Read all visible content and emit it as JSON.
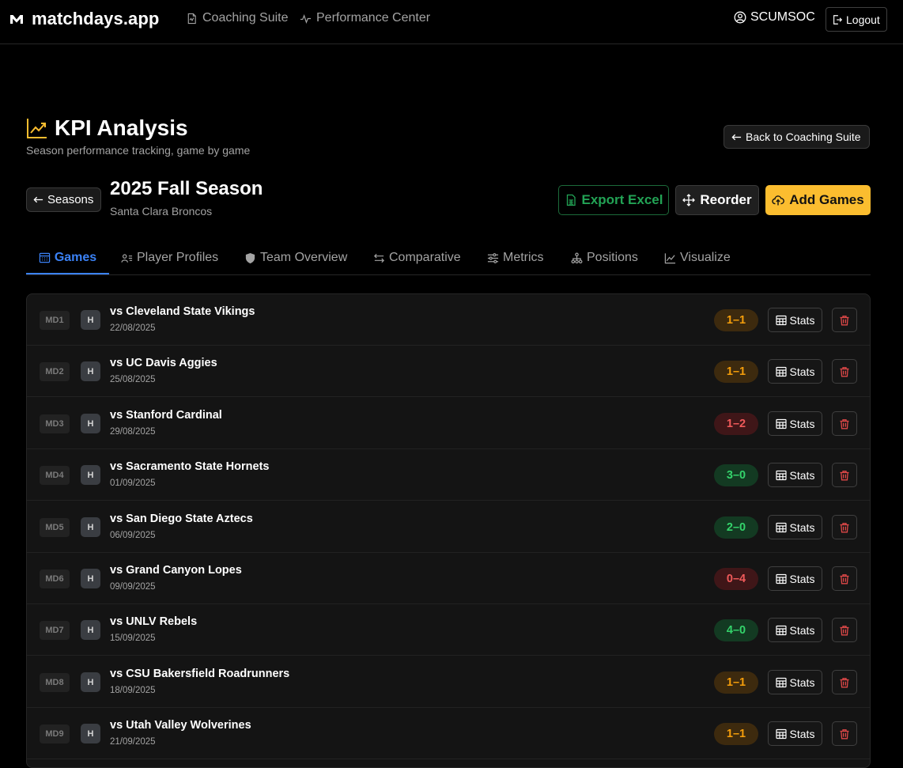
{
  "nav": {
    "brand": "matchdays.app",
    "links": [
      {
        "label": "Coaching Suite"
      },
      {
        "label": "Performance Center"
      }
    ],
    "user": "SCUMSOC",
    "logout": "Logout"
  },
  "header": {
    "title": "KPI Analysis",
    "subtitle": "Season performance tracking, game by game",
    "back_button": "Back to Coaching Suite"
  },
  "season": {
    "back_label": "Seasons",
    "title": "2025 Fall Season",
    "team": "Santa Clara Broncos"
  },
  "actions": {
    "export": "Export Excel",
    "reorder": "Reorder",
    "add": "Add Games"
  },
  "tabs": [
    {
      "label": "Games",
      "icon": "calendar-icon"
    },
    {
      "label": "Player Profiles",
      "icon": "player-card-icon"
    },
    {
      "label": "Team Overview",
      "icon": "shield-icon"
    },
    {
      "label": "Comparative",
      "icon": "arrows-compare-icon"
    },
    {
      "label": "Metrics",
      "icon": "sliders-icon"
    },
    {
      "label": "Positions",
      "icon": "positions-icon"
    },
    {
      "label": "Visualize",
      "icon": "line-chart-icon"
    }
  ],
  "colors": {
    "accent": "#3b82f6",
    "brand_yellow": "#fbbd2f",
    "export_green": "#22a355",
    "draw_text": "#f59e0b",
    "draw_bg": "#3d2a0e",
    "loss_text": "#f05a5a",
    "loss_bg": "#3f1618",
    "win_text": "#34d36b",
    "win_bg": "#133a22",
    "delete_red": "#e04848"
  },
  "games": [
    {
      "md": "MD1",
      "venue": "H",
      "opponent": "vs Cleveland State Vikings",
      "date": "22/08/2025",
      "score": "1–1",
      "result": "draw",
      "stats": "Stats"
    },
    {
      "md": "MD2",
      "venue": "H",
      "opponent": "vs UC Davis Aggies",
      "date": "25/08/2025",
      "score": "1–1",
      "result": "draw",
      "stats": "Stats"
    },
    {
      "md": "MD3",
      "venue": "H",
      "opponent": "vs Stanford Cardinal",
      "date": "29/08/2025",
      "score": "1–2",
      "result": "loss",
      "stats": "Stats"
    },
    {
      "md": "MD4",
      "venue": "H",
      "opponent": "vs Sacramento State Hornets",
      "date": "01/09/2025",
      "score": "3–0",
      "result": "win",
      "stats": "Stats"
    },
    {
      "md": "MD5",
      "venue": "H",
      "opponent": "vs San Diego State Aztecs",
      "date": "06/09/2025",
      "score": "2–0",
      "result": "win",
      "stats": "Stats"
    },
    {
      "md": "MD6",
      "venue": "H",
      "opponent": "vs Grand Canyon Lopes",
      "date": "09/09/2025",
      "score": "0–4",
      "result": "loss",
      "stats": "Stats"
    },
    {
      "md": "MD7",
      "venue": "H",
      "opponent": "vs UNLV Rebels",
      "date": "15/09/2025",
      "score": "4–0",
      "result": "win",
      "stats": "Stats"
    },
    {
      "md": "MD8",
      "venue": "H",
      "opponent": "vs CSU Bakersfield Roadrunners",
      "date": "18/09/2025",
      "score": "1–1",
      "result": "draw",
      "stats": "Stats"
    },
    {
      "md": "MD9",
      "venue": "H",
      "opponent": "vs Utah Valley Wolverines",
      "date": "21/09/2025",
      "score": "1–1",
      "result": "draw",
      "stats": "Stats"
    }
  ]
}
